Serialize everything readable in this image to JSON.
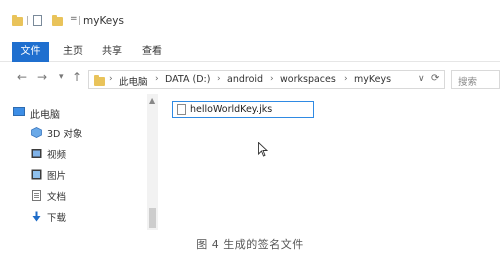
{
  "window": {
    "title": "myKeys",
    "qa_dropdown": "=",
    "qa_arrow": "▾"
  },
  "ribbon": {
    "tabs": [
      {
        "label": "文件"
      },
      {
        "label": "主页"
      },
      {
        "label": "共享"
      },
      {
        "label": "查看"
      }
    ]
  },
  "nav_buttons": {
    "back": "←",
    "forward": "→",
    "recent": "▾",
    "up": "↑"
  },
  "address": {
    "crumbs": [
      "此电脑",
      "DATA (D:)",
      "android",
      "workspaces",
      "myKeys"
    ],
    "separator": "›",
    "dropdown": "∨",
    "refresh": "⟳"
  },
  "search": {
    "placeholder": "搜索"
  },
  "sidebar": {
    "root": {
      "label": "此电脑"
    },
    "items": [
      {
        "label": "3D 对象",
        "icon": "3d-objects-icon"
      },
      {
        "label": "视频",
        "icon": "video-icon"
      },
      {
        "label": "图片",
        "icon": "pictures-icon"
      },
      {
        "label": "文档",
        "icon": "documents-icon"
      },
      {
        "label": "下载",
        "icon": "download-icon"
      }
    ]
  },
  "content": {
    "files": [
      {
        "name": "helloWorldKey.jks"
      }
    ]
  },
  "caption": "图 4  生成的签名文件",
  "colors": {
    "file_tab": "#1f6fcf",
    "folder": "#e9c35a",
    "selection_border": "#2f8ae3"
  }
}
